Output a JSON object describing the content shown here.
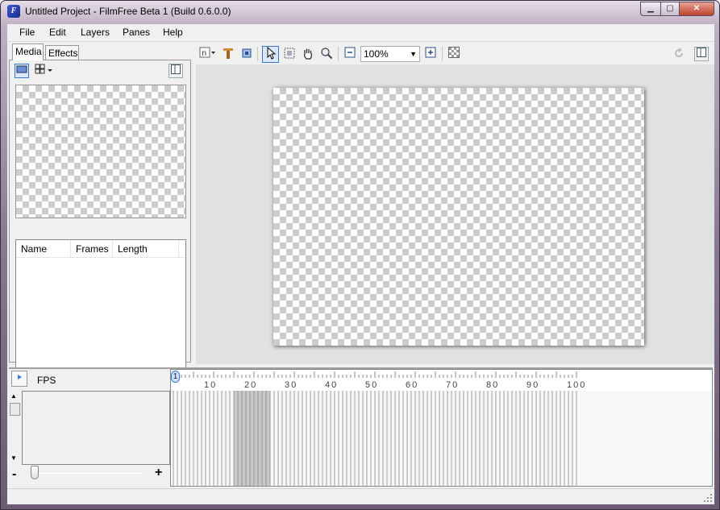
{
  "window": {
    "title": "Untitled Project - FilmFree Beta 1 (Build 0.6.0.0)",
    "app_icon_glyph": "F"
  },
  "menu": [
    "File",
    "Edit",
    "Layers",
    "Panes",
    "Help"
  ],
  "left_pane": {
    "tabs": [
      "Media",
      "Effects"
    ],
    "active_tab": "Media",
    "columns": [
      "Name",
      "Frames",
      "Length"
    ]
  },
  "toolbar": {
    "zoom_value": "100%"
  },
  "timeline": {
    "fps_label": "FPS",
    "current_frame": "1",
    "ruler_labels": [
      "10",
      "20",
      "30",
      "40",
      "50",
      "60",
      "70",
      "80",
      "90",
      "100"
    ],
    "zoom_minus": "-",
    "zoom_plus": "+",
    "total_frames": 100,
    "highlight_start_frame": 15,
    "highlight_end_frame": 24
  },
  "colors": {
    "accent": "#3b74d6",
    "highlight_band": "#c8c8c8"
  }
}
